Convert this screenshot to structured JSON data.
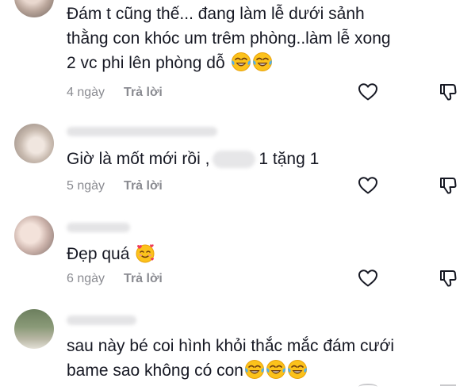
{
  "comments": [
    {
      "lines": [
        "Đám t cũng thế... đang làm lễ dưới sảnh",
        "thằng con khóc um trêm phòng..làm lễ xong",
        "2 vc phi lên phòng dỗ"
      ],
      "emojis": [
        "face-with-tears-of-joy-icon",
        "face-with-tears-of-joy-icon"
      ],
      "time": "4 ngày",
      "reply": "Trả lời"
    },
    {
      "text_before": "Giờ là mốt mới rồi ,",
      "text_after": "1 tặng 1",
      "time": "5 ngày",
      "reply": "Trả lời"
    },
    {
      "text": "Đẹp quá",
      "emojis": [
        "smiling-face-with-hearts-icon"
      ],
      "time": "6 ngày",
      "reply": "Trả lời"
    },
    {
      "lines": [
        "sau này bé coi hình khỏi thắc mắc đám cưới",
        "bame sao không có con"
      ],
      "emojis": [
        "face-with-tears-of-joy-icon",
        "face-with-tears-of-joy-icon",
        "face-with-tears-of-joy-icon"
      ]
    }
  ]
}
